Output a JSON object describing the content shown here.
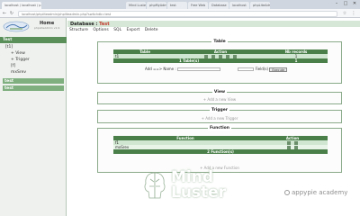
{
  "browser": {
    "tabs": [
      {
        "label": "localhost / localhost / p"
      },
      {
        "label": "Mind Luster"
      },
      {
        "label": "phpMyAdmin"
      },
      {
        "label": "test"
      },
      {
        "label": "Free Web"
      },
      {
        "label": "Database"
      },
      {
        "label": "localhost"
      },
      {
        "label": "phpLiteAdmin"
      }
    ],
    "url": "localhost/phpliteadmin/phpliteadmin.php?switchdb=test"
  },
  "sidebar": {
    "home_label": "Home",
    "home_sub": "phpLiteAdmin v1.9",
    "db_header": "Test",
    "items": [
      {
        "label": "[t1]"
      },
      {
        "label": "+ View"
      },
      {
        "label": "+ Trigger"
      },
      {
        "label": "[f]"
      },
      {
        "label": "mxSrev"
      }
    ],
    "links": [
      {
        "label": "test"
      },
      {
        "label": "test"
      }
    ]
  },
  "main": {
    "db_label": "Database : ",
    "db_name": "Test",
    "menu": [
      "Structure",
      "Options",
      "SQL",
      "Export",
      "Delete"
    ],
    "table_section": {
      "legend": "Table",
      "headers": [
        "Table",
        "Action",
        "Nb records"
      ],
      "rows": [
        {
          "name": "t1",
          "records": "1"
        }
      ],
      "footer_label": "1 Table(s)",
      "footer_count": "1"
    },
    "add_form": {
      "label": "Add ==> Name :",
      "fields_label": "Field(s)",
      "execute_label": "Execute"
    },
    "view_section": {
      "legend": "View",
      "add_link": "+ Add a new View"
    },
    "trigger_section": {
      "legend": "Trigger",
      "add_link": "+ Add a new Trigger"
    },
    "function_section": {
      "legend": "Function",
      "headers": [
        "Function",
        "Action"
      ],
      "rows": [
        {
          "name": "f1"
        },
        {
          "name": "mxSrev"
        }
      ],
      "footer_label": "2 Function(s)",
      "add_link": "+ Add a new Function"
    }
  },
  "watermarks": {
    "brand_line1": "Mind",
    "brand_line2": "Luster",
    "academy": "appypie academy"
  },
  "colors": {
    "header_green": "#4a7f4a",
    "row_green": "#d0e6d0",
    "sidebar_green": "#5a8f5a"
  }
}
